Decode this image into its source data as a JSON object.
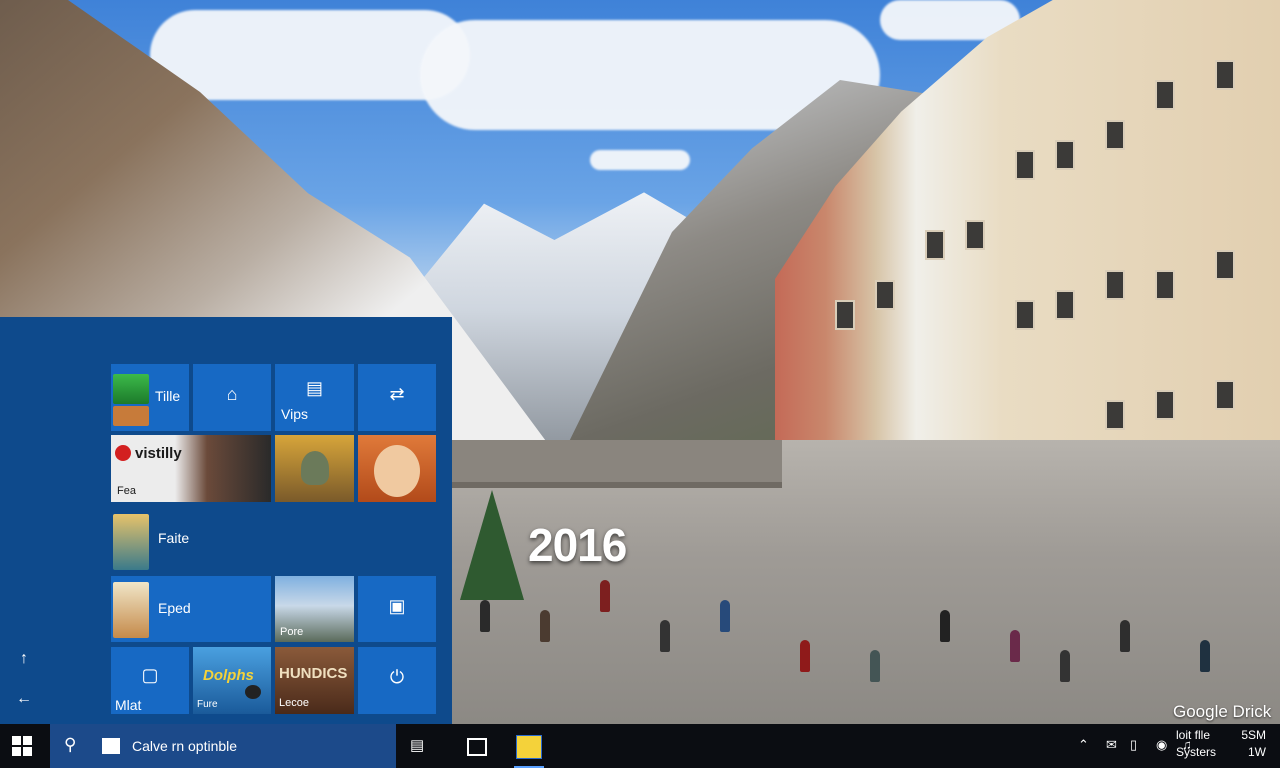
{
  "wallpaper": {
    "overlay_year": "2016",
    "watermark": "Google Drick"
  },
  "start_menu": {
    "rail": {
      "up_icon": "arrow-up-icon",
      "back_icon": "arrow-left-icon"
    },
    "tiles": [
      {
        "id": "tile-1",
        "label": "Tille",
        "icon": "store-icon"
      },
      {
        "id": "tile-2",
        "label": "",
        "icon": "home-icon"
      },
      {
        "id": "tile-3",
        "label": "Vips",
        "icon": "doc-icon"
      },
      {
        "id": "tile-4",
        "label": "",
        "icon": "sync-icon"
      },
      {
        "id": "tile-5",
        "label": "Fea",
        "brand": "vistilly",
        "icon": "app-logo-icon"
      },
      {
        "id": "tile-6",
        "label": "",
        "icon": "photo-game-icon"
      },
      {
        "id": "tile-7",
        "label": "",
        "icon": "photo-portrait-icon"
      },
      {
        "id": "tile-8",
        "label": "Faite",
        "icon": "travel-icon"
      },
      {
        "id": "tile-9",
        "label": "Eped",
        "icon": "news-icon"
      },
      {
        "id": "tile-10",
        "label": "Pore",
        "icon": "mountain-photo-icon"
      },
      {
        "id": "tile-11",
        "label": "",
        "icon": "calendar-icon"
      },
      {
        "id": "tile-12",
        "label": "Mlat",
        "icon": "bag-icon"
      },
      {
        "id": "tile-13",
        "label": "Fure",
        "brand": "Dolphs",
        "icon": "bird-photo-icon"
      },
      {
        "id": "tile-14",
        "label": "Lecoe",
        "brand": "HUNDICS",
        "icon": "poster-icon"
      },
      {
        "id": "tile-15",
        "label": "",
        "icon": "power-icon"
      }
    ]
  },
  "taskbar": {
    "start_icon": "windows-logo-icon",
    "search_icon": "search-icon",
    "search_text": "Calve rn optinble",
    "search_mic_icon": "box-icon",
    "task_view_icon": "task-view-icon",
    "pinned_app_icon": "notes-icon",
    "tray": [
      "chevron-up-icon",
      "message-icon",
      "battery-icon",
      "network-icon",
      "volume-icon"
    ],
    "clock": {
      "line1": "loit flle",
      "line2": "Systers",
      "line3": "5SM",
      "line4": "1W"
    }
  },
  "colors": {
    "start_bg": "#0e4a8c",
    "tile": "#1769c4",
    "taskbar": "#0b0d12",
    "search_box": "#1c4a8a"
  }
}
